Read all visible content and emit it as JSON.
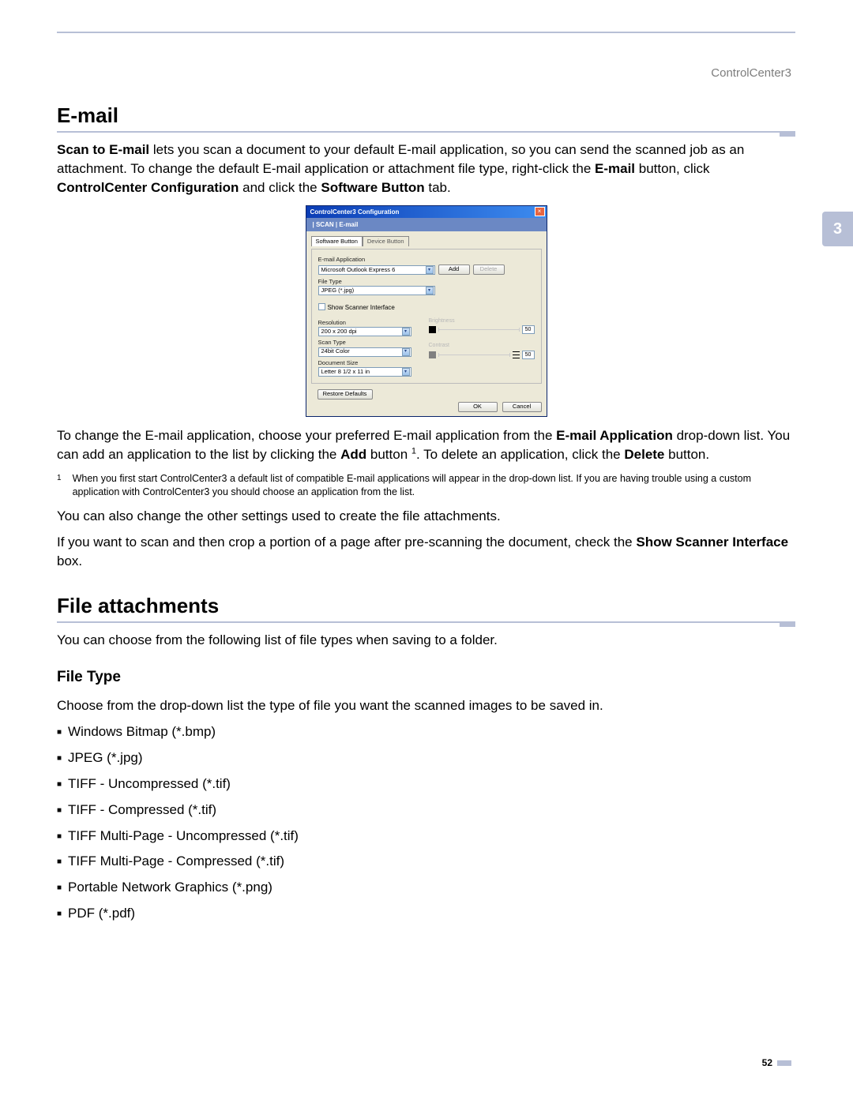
{
  "header": {
    "product": "ControlCenter3"
  },
  "chapter": {
    "number": "3",
    "pageNumber": "52"
  },
  "section_email": {
    "title": "E-mail",
    "para1": {
      "bold1": "Scan to E-mail",
      "text1": " lets you scan a document to your default E-mail application, so you can send the scanned job as an attachment. To change the default E-mail application or attachment file type, right-click the ",
      "bold2": "E-mail",
      "text2": " button, click ",
      "bold3": "ControlCenter Configuration",
      "text3": " and click the ",
      "bold4": "Software Button",
      "text4": " tab."
    },
    "para2": {
      "pre": "To change the E-mail application, choose your preferred E-mail application from the ",
      "bold1": "E-mail Application",
      "mid1": " drop-down list. You can add an application to the list by clicking the ",
      "bold2": "Add",
      "mid2": " button ",
      "sup": "1",
      "mid3": ". To delete an application, click the ",
      "bold3": "Delete",
      "mid4": " button."
    },
    "footnote": {
      "num": "1",
      "text": "When you first start ControlCenter3 a default list of compatible E-mail applications will appear in the drop-down list. If you are having trouble using a custom application with ControlCenter3 you should choose an application from the list."
    },
    "para3": "You can also change the other settings used to create the file attachments.",
    "para4": {
      "pre": "If you want to scan and then crop a portion of a page after pre-scanning the document, check the ",
      "bold1": "Show Scanner Interface",
      "post": " box."
    }
  },
  "dialog": {
    "title": "ControlCenter3 Configuration",
    "band": "| SCAN | E-mail",
    "tabs": {
      "active": "Software Button",
      "inactive": "Device Button"
    },
    "labels": {
      "emailApp": "E-mail Application",
      "fileType": "File Type",
      "showScanner": "Show Scanner Interface",
      "resolution": "Resolution",
      "scanType": "Scan Type",
      "docSize": "Document Size",
      "brightness": "Brightness",
      "contrast": "Contrast"
    },
    "values": {
      "emailApp": "Microsoft Outlook Express 6",
      "fileType": "JPEG (*.jpg)",
      "resolution": "200 x 200 dpi",
      "scanType": "24bit Color",
      "docSize": "Letter 8 1/2 x 11 in",
      "brightness": "50",
      "contrast": "50"
    },
    "buttons": {
      "add": "Add",
      "delete": "Delete",
      "restore": "Restore Defaults",
      "ok": "OK",
      "cancel": "Cancel"
    }
  },
  "section_fileattach": {
    "title": "File attachments",
    "intro": "You can choose from the following list of file types when saving to a folder.",
    "subhead": "File Type",
    "desc": "Choose from the drop-down list the type of file you want the scanned images to be saved in.",
    "types": [
      "Windows Bitmap (*.bmp)",
      "JPEG (*.jpg)",
      "TIFF - Uncompressed (*.tif)",
      "TIFF - Compressed (*.tif)",
      "TIFF Multi-Page - Uncompressed (*.tif)",
      "TIFF Multi-Page - Compressed (*.tif)",
      "Portable Network Graphics (*.png)",
      "PDF (*.pdf)"
    ]
  }
}
